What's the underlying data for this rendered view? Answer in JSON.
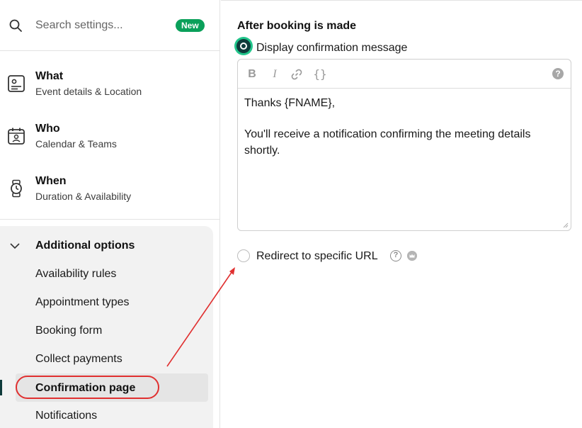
{
  "search": {
    "placeholder": "Search settings...",
    "badge": "New"
  },
  "nav": [
    {
      "title": "What",
      "subtitle": "Event details & Location",
      "icon": "event-details-icon"
    },
    {
      "title": "Who",
      "subtitle": "Calendar & Teams",
      "icon": "calendar-icon"
    },
    {
      "title": "When",
      "subtitle": "Duration & Availability",
      "icon": "watch-icon"
    }
  ],
  "additional": {
    "title": "Additional options",
    "items": [
      {
        "label": "Availability rules"
      },
      {
        "label": "Appointment types"
      },
      {
        "label": "Booking form"
      },
      {
        "label": "Collect payments"
      },
      {
        "label": "Confirmation page",
        "active": true
      },
      {
        "label": "Notifications"
      }
    ]
  },
  "main": {
    "section_title": "After booking is made",
    "option_message": "Display confirmation message",
    "option_message_selected": true,
    "editor": {
      "toolbar": {
        "bold": "B",
        "italic": "I",
        "link": "link-icon",
        "variable": "{}",
        "help": "?"
      },
      "line1": "Thanks {FNAME},",
      "line2": "You'll receive a notification confirming the meeting details shortly."
    },
    "option_redirect": "Redirect to specific URL",
    "option_redirect_selected": false
  },
  "colors": {
    "accent_dark": "#0f3b3b",
    "accent_green": "#22c58b",
    "badge_green": "#0aa05a",
    "annotation_red": "#e03030"
  }
}
